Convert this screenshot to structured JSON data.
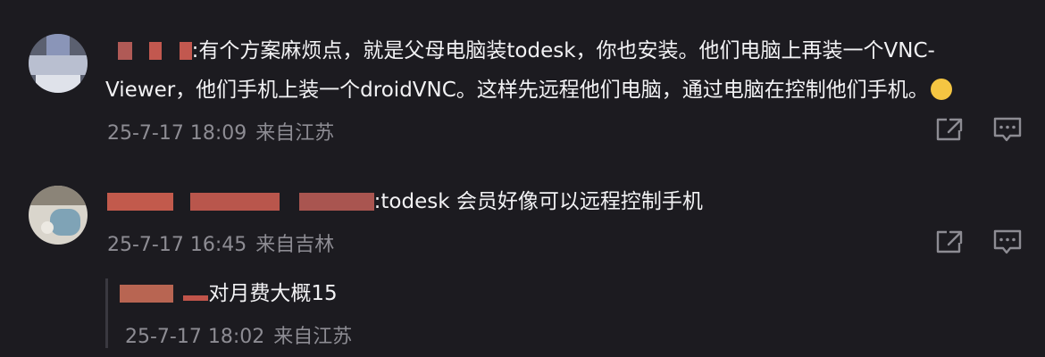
{
  "comments": [
    {
      "content_line1": ":有个方案麻烦点，就是父母电脑装todesk，你也安装。他们电脑上再装一个VNC-",
      "content_line2": "Viewer，他们手机上装一个droidVNC。这样先远程他们电脑，通过电脑在控制他们手机。",
      "timestamp": "25-7-17 18:09",
      "location": "来自江苏"
    },
    {
      "content": ":todesk 会员好像可以远程控制手机",
      "timestamp": "25-7-17 16:45",
      "location": "来自吉林",
      "replies": [
        {
          "content": "对月费大概15",
          "timestamp": "25-7-17 18:02",
          "location": "来自江苏"
        }
      ]
    }
  ],
  "icons": {
    "share": "share-icon",
    "reply": "comment-icon",
    "emoji": "crying-laughing-emoji-icon"
  },
  "colors": {
    "background": "#1c1b20",
    "text": "#f2f2f4",
    "meta": "#8d8c93",
    "masked_name": "#e0604f"
  }
}
